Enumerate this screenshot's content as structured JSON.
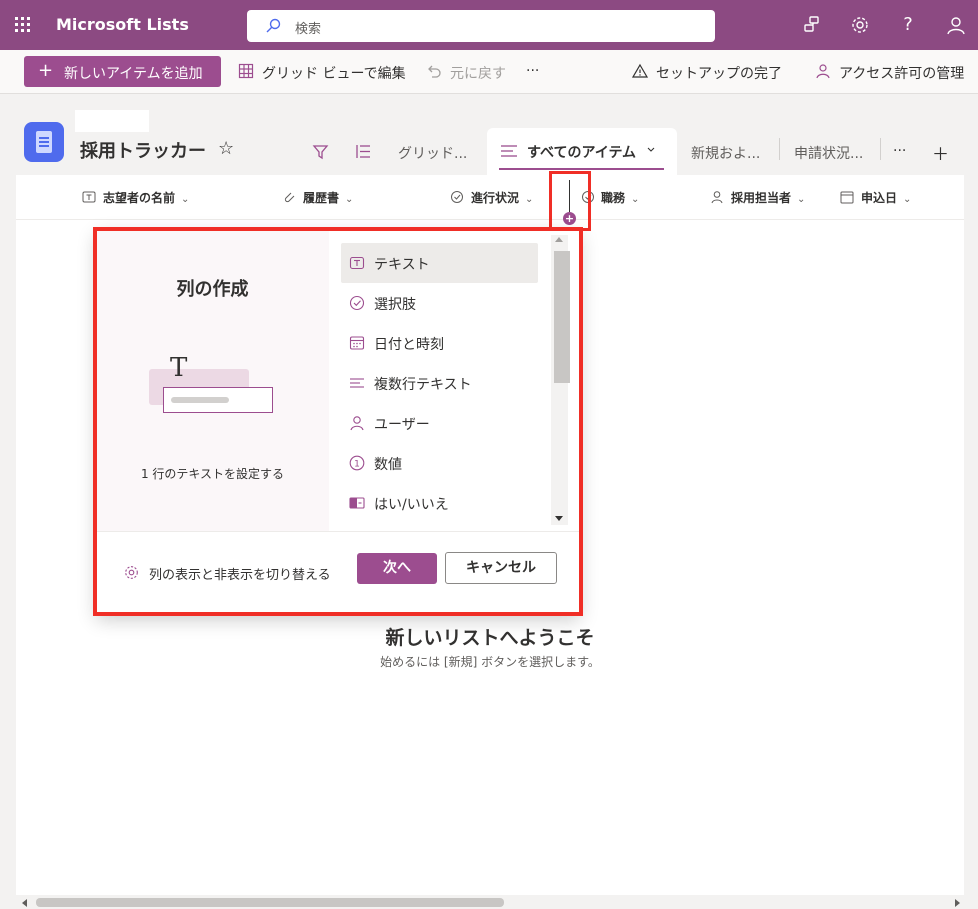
{
  "app": {
    "title": "Microsoft Lists"
  },
  "search": {
    "placeholder": "検索"
  },
  "suite_icons": [
    "share-icon",
    "settings-icon",
    "help-icon",
    "account-icon"
  ],
  "help_glyph": "?",
  "commandbar": {
    "new_item": "新しいアイテムを追加",
    "grid_edit": "グリッド ビューで編集",
    "undo": "元に戻す",
    "more": "···",
    "setup_complete": "セットアップの完了",
    "manage_access": "アクセス許可の管理"
  },
  "list": {
    "title": "採用トラッカー",
    "favorite_glyph": "☆"
  },
  "views": {
    "grid": "グリッド...",
    "all_items": "すべてのアイテム",
    "new_and": "新規およ...",
    "status": "申請状況...",
    "more": "···",
    "add": "＋"
  },
  "columns": [
    {
      "label": "志望者の名前",
      "icon": "text-column-icon"
    },
    {
      "label": "履歴書",
      "icon": "attachment-icon"
    },
    {
      "label": "進行状況",
      "icon": "choice-column-icon"
    },
    {
      "label": "職務",
      "icon": "choice-column-icon"
    },
    {
      "label": "採用担当者",
      "icon": "person-icon"
    },
    {
      "label": "申込日",
      "icon": "calendar-icon"
    }
  ],
  "dialog": {
    "title": "列の作成",
    "illustration_glyph": "T",
    "description": "1 行のテキストを設定する",
    "types": [
      {
        "label": "テキスト",
        "icon": "text-type-icon",
        "selected": true
      },
      {
        "label": "選択肢",
        "icon": "choice-type-icon",
        "selected": false
      },
      {
        "label": "日付と時刻",
        "icon": "calendar-type-icon",
        "selected": false
      },
      {
        "label": "複数行テキスト",
        "icon": "multiline-type-icon",
        "selected": false
      },
      {
        "label": "ユーザー",
        "icon": "person-type-icon",
        "selected": false
      },
      {
        "label": "数値",
        "icon": "number-type-icon",
        "selected": false
      },
      {
        "label": "はい/いいえ",
        "icon": "yesno-type-icon",
        "selected": false
      }
    ],
    "toggle_columns": "列の表示と非表示を切り替える",
    "next": "次へ",
    "cancel": "キャンセル"
  },
  "empty_state": {
    "title": "新しいリストへようこそ",
    "subtitle": "始めるには [新規] ボタンを選択します。"
  },
  "colors": {
    "suite": "#8c4a82",
    "accent": "#9c4d8f",
    "highlight": "#f02e26",
    "list_logo": "#4f6bed"
  }
}
